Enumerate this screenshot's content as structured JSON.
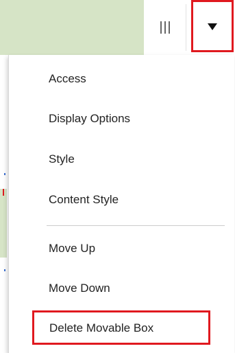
{
  "header": {
    "columns_icon": "columns-icon",
    "menu_toggle_icon": "caret-down-icon",
    "highlight_color": "#e0191f",
    "header_color": "#d6e4c6"
  },
  "menu": {
    "items": [
      {
        "label": "Access"
      },
      {
        "label": "Display Options"
      },
      {
        "label": "Style"
      },
      {
        "label": "Content Style"
      },
      {
        "label": "Move Up"
      },
      {
        "label": "Move Down"
      },
      {
        "label": "Delete Movable Box"
      }
    ]
  }
}
